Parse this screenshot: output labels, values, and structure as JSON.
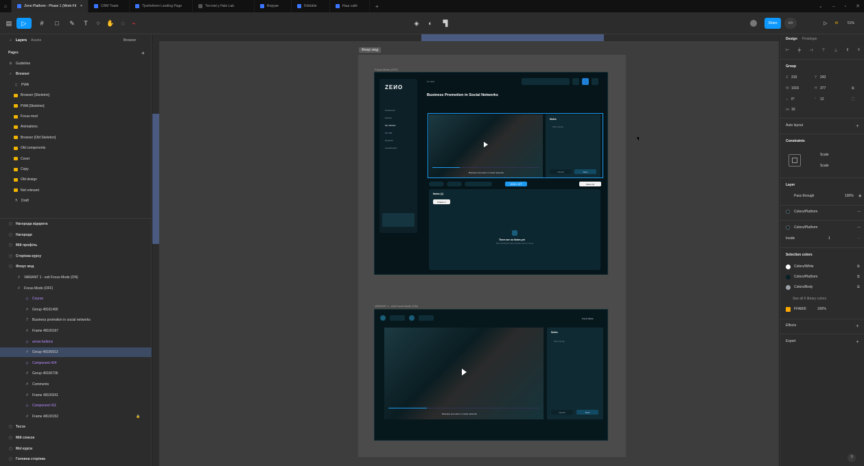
{
  "tabs": [
    {
      "label": "Zeno Platform - Phase 1 (Work-Fil"
    },
    {
      "label": "CRM Trade"
    },
    {
      "label": "Tjovhelmen Landing Page"
    },
    {
      "label": "Тестові у Halo Lab"
    },
    {
      "label": "Форуки"
    },
    {
      "label": "Dribbble"
    },
    {
      "label": "Наш сайт"
    }
  ],
  "toolbar": {
    "share_label": "Share",
    "zoom_label": "51%"
  },
  "layers_panel": {
    "tab_layers": "Layers",
    "tab_assets": "Assets",
    "browser_label": "Browser",
    "pages_heading": "Pages",
    "pages": [
      "Guideline",
      "Browser",
      "PWA",
      "Browser [Skeleton]",
      "PWA [Skeleton]",
      "Focus mod",
      "Animations",
      "Browser [Old Skeleton]",
      "Old components",
      "Cover",
      "Copy",
      "Old design",
      "Not relevant",
      "Draft"
    ],
    "frames": [
      "Нагорода відкрита",
      "Нагороди",
      "Мій профіль",
      "Сторінка курсу",
      "Фокус мод",
      "VARIANT 1 - exit Focus Mode (ON)",
      "Focus Mode (OFF)",
      "Course",
      "Group 48101490",
      "Business promotion in social networks",
      "Frame 48100167",
      "arrow buttons",
      "Group 48100913",
      "Component 424",
      "Group 48100736",
      "Comments",
      "Frame 48100241",
      "Component 411",
      "Frame 48100152",
      "Тести",
      "Мій список",
      "Мої курси",
      "Головна сторінка"
    ]
  },
  "canvas": {
    "section_label": "Фокус мод",
    "frame1_label": "Focus Mode (OFF)",
    "frame2_label": "VARIANT 1 - exit Focus Mode (ON)",
    "mock": {
      "logo": "ZEИO",
      "back": "Go back",
      "course_title": "Business Promotion in Social Networks",
      "nav": [
        "Dashboard",
        "Explore",
        "My Classes",
        "My Skill",
        "Rewards",
        "Leaderboard"
      ],
      "notes_title": "Notes",
      "notes_placeholder": "Start typing...",
      "cancel": "Cancel",
      "save": "Save",
      "selection_size": "1016 × 377",
      "notes_count": "Notes (1)",
      "chapter": "Chapter 1",
      "empty_title": "There are no Notes yet",
      "empty_sub": "Start pressing the Save and take notes on the go",
      "video_caption": "Business promotion in social networks",
      "focus_mode_label": "Focus Mode",
      "tab_notes": "Notes (2)"
    }
  },
  "design_panel": {
    "tab_design": "Design",
    "tab_prototype": "Prototype",
    "group_label": "Group",
    "x": "319",
    "y": "243",
    "w": "1016",
    "h": "377",
    "rotation": "0°",
    "radius": "12",
    "gap": "16",
    "auto_layout": "Auto layout",
    "constraints": "Constraints",
    "scale_h": "Scale",
    "scale_v": "Scale",
    "layer": "Layer",
    "pass_through": "Pass through",
    "opacity": "100%",
    "fill1": "Colors/Platform",
    "fill2": "Colors/Platform",
    "stroke_pos": "Inside",
    "stroke_w": "1",
    "selection_colors": "Selection colors",
    "colors": [
      {
        "name": "Colors/White",
        "hex": "#ffffff"
      },
      {
        "name": "Colors/Platform",
        "hex": "#0b1f26"
      },
      {
        "name": "Colors/Body",
        "hex": "#9aa0a6"
      }
    ],
    "see_all": "See all 6 library colors",
    "hex_fill": "FFA800",
    "hex_opacity": "100%",
    "effects": "Effects",
    "export": "Export"
  }
}
